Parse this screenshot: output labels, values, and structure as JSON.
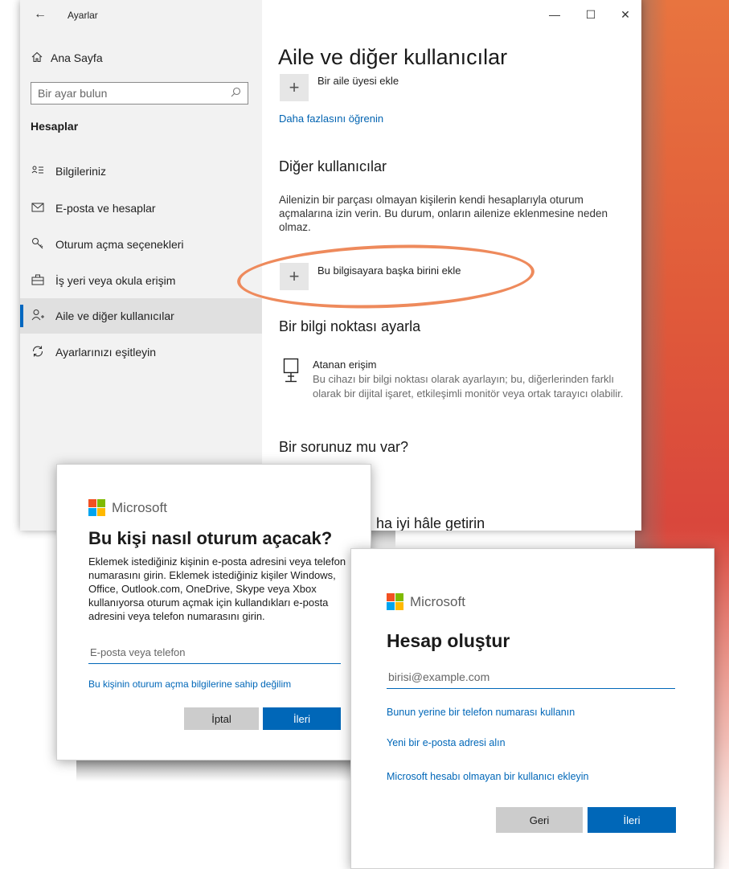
{
  "window": {
    "title": "Ayarlar",
    "back": "←",
    "minimize": "—",
    "maximize": "☐",
    "close": "✕"
  },
  "sidebar": {
    "home": "Ana Sayfa",
    "search_placeholder": "Bir ayar bulun",
    "section": "Hesaplar",
    "items": [
      {
        "label": "Bilgileriniz",
        "icon": "person-card-icon"
      },
      {
        "label": "E-posta ve hesaplar",
        "icon": "mail-icon"
      },
      {
        "label": "Oturum açma seçenekleri",
        "icon": "key-icon"
      },
      {
        "label": "İş yeri veya okula erişim",
        "icon": "briefcase-icon"
      },
      {
        "label": "Aile ve diğer kullanıcılar",
        "icon": "person-add-icon",
        "active": true
      },
      {
        "label": "Ayarlarınızı eşitleyin",
        "icon": "sync-icon"
      }
    ]
  },
  "main": {
    "title": "Aile ve diğer kullanıcılar",
    "add_family": "Bir aile üyesi ekle",
    "learn_more": "Daha fazlasını öğrenin",
    "other_users_heading": "Diğer kullanıcılar",
    "other_users_text": "Ailenizin bir parçası olmayan kişilerin kendi hesaplarıyla oturum açmalarına izin verin. Bu durum, onların ailenize eklenmesine neden olmaz.",
    "add_other": "Bu bilgisayara başka birini ekle",
    "kiosk_heading": "Bir bilgi noktası ayarla",
    "kiosk_title": "Atanan erişim",
    "kiosk_desc": "Bu cihazı bir bilgi noktası olarak ayarlayın; bu, diğerlerinden farklı olarak bir dijital işaret, etkileşimli monitör veya ortak tarayıcı olabilir.",
    "question_heading": "Bir sorunuz mu var?",
    "partial_heading": "ha iyi hâle getirin"
  },
  "dialog_signin": {
    "brand": "Microsoft",
    "title": "Bu kişi nasıl oturum açacak?",
    "text": "Eklemek istediğiniz kişinin e-posta adresini veya telefon numarasını girin. Eklemek istediğiniz kişiler Windows, Office, Outlook.com, OneDrive, Skype veya Xbox kullanıyorsa oturum açmak için kullandıkları e-posta adresini veya telefon numarasını girin.",
    "input_placeholder": "E-posta veya telefon",
    "no_info_link": "Bu kişinin oturum açma bilgilerine sahip değilim",
    "cancel": "İptal",
    "next": "İleri"
  },
  "dialog_create": {
    "brand": "Microsoft",
    "title": "Hesap oluştur",
    "input_placeholder": "birisi@example.com",
    "phone_link": "Bunun yerine bir telefon numarası kullanın",
    "new_email_link": "Yeni bir e-posta adresi alın",
    "no_ms_link": "Microsoft hesabı olmayan bir kullanıcı ekleyin",
    "back": "Geri",
    "next": "İleri"
  },
  "colors": {
    "accent": "#0067b8",
    "ms_red": "#f25022",
    "ms_green": "#7fba00",
    "ms_blue": "#00a4ef",
    "ms_yellow": "#ffb900",
    "highlight_ellipse": "#ee8a5c"
  }
}
